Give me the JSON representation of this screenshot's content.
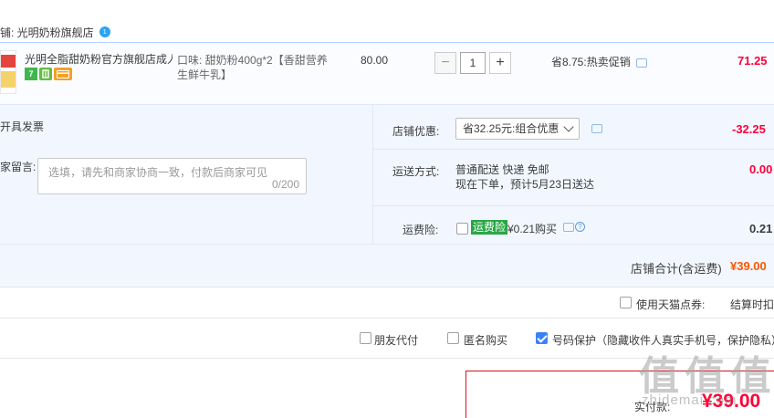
{
  "store": {
    "name": "铺: 光明奶粉旗舰店",
    "badge": "1"
  },
  "item": {
    "title": "光明全脂甜奶粉官方旗舰店成人...",
    "spec": "口味: 甜奶粉400g*2【香甜营养生鲜牛乳】",
    "price": "80.00",
    "quantity": "1",
    "minus": "−",
    "plus": "+",
    "promo": "省8.75:热卖促销",
    "subtotal": "71.25",
    "icon_seven": "7"
  },
  "options": {
    "invoice_label": "开具发票",
    "note_label": "家留言:",
    "note_placeholder": "选填，请先和商家协商一致，付款后商家可见",
    "note_count": "0/200",
    "coupon_label": "店铺优惠:",
    "coupon_value": "省32.25元:组合优惠",
    "coupon_amount": "-32.25",
    "shipping_label": "运送方式:",
    "shipping_line1": "普通配送 快递 免邮",
    "shipping_line2": "现在下单，预计5月23日送达",
    "shipping_amount": "0.00",
    "insurance_label": "运费险:",
    "insurance_tag": "运费险",
    "insurance_price": "¥0.21购买",
    "insurance_amount": "0.21",
    "help_glyph": "?"
  },
  "total": {
    "label": "店铺合计(含运费)",
    "value": "¥39.00"
  },
  "points": {
    "label": "使用天猫点券:",
    "trailing": "结算时扣除"
  },
  "checkout_options": {
    "friend_pay": "朋友代付",
    "anonymous": "匿名购买",
    "number_protect": "号码保护（隐藏收件人真实手机号，保护隐私）"
  },
  "pay": {
    "label": "实付款:",
    "value": "¥39.00"
  },
  "watermark": {
    "main": "值 值 值",
    "sub": "zhidemai.com"
  },
  "colors": {
    "accent_red": "#ff0036",
    "orange": "#ff5500",
    "row_border_blue": "#b2d1ff",
    "panel_bg": "#f2f7ff",
    "checkbox_blue": "#3b82f6"
  }
}
